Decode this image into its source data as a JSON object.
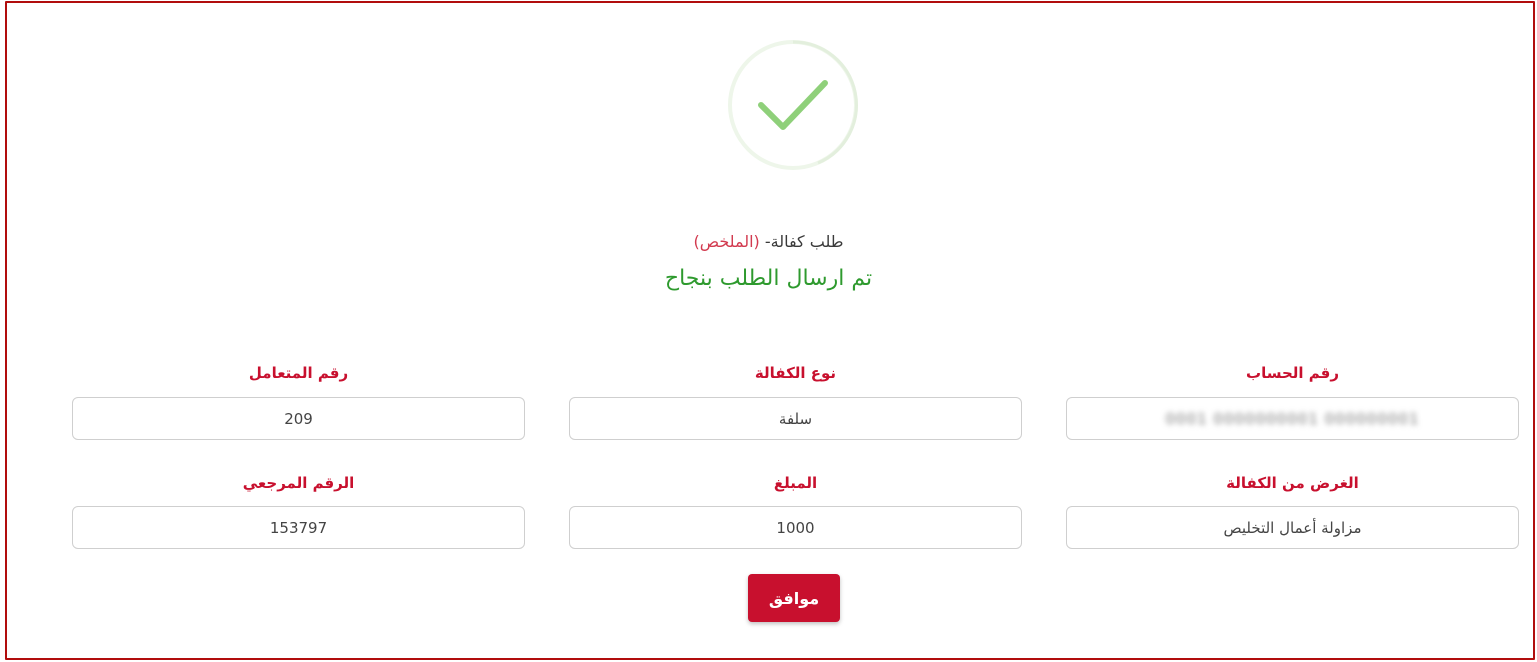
{
  "header": {
    "breadcrumb_parent": "طلب كفالة-",
    "breadcrumb_current": "(الملخص)",
    "success_message": "تم ارسال الطلب بنجاح",
    "icon": "check-circle-icon"
  },
  "fields": {
    "account_number": {
      "label": "رقم الحساب",
      "value": "0001 0000000001 000000001"
    },
    "guarantee_type": {
      "label": "نوع الكفالة",
      "value": "سلفة"
    },
    "customer_number": {
      "label": "رقم المتعامل",
      "value": "209"
    },
    "guarantee_purpose": {
      "label": "الغرض من الكفالة",
      "value": "مزاولة أعمال التخليص"
    },
    "amount": {
      "label": "المبلغ",
      "value": "1000"
    },
    "reference_number": {
      "label": "الرقم المرجعي",
      "value": "153797"
    }
  },
  "actions": {
    "ok_label": "موافق"
  },
  "colors": {
    "brand": "#c8102e",
    "success": "#2e9a2e",
    "frame_border": "#b10d0d"
  }
}
